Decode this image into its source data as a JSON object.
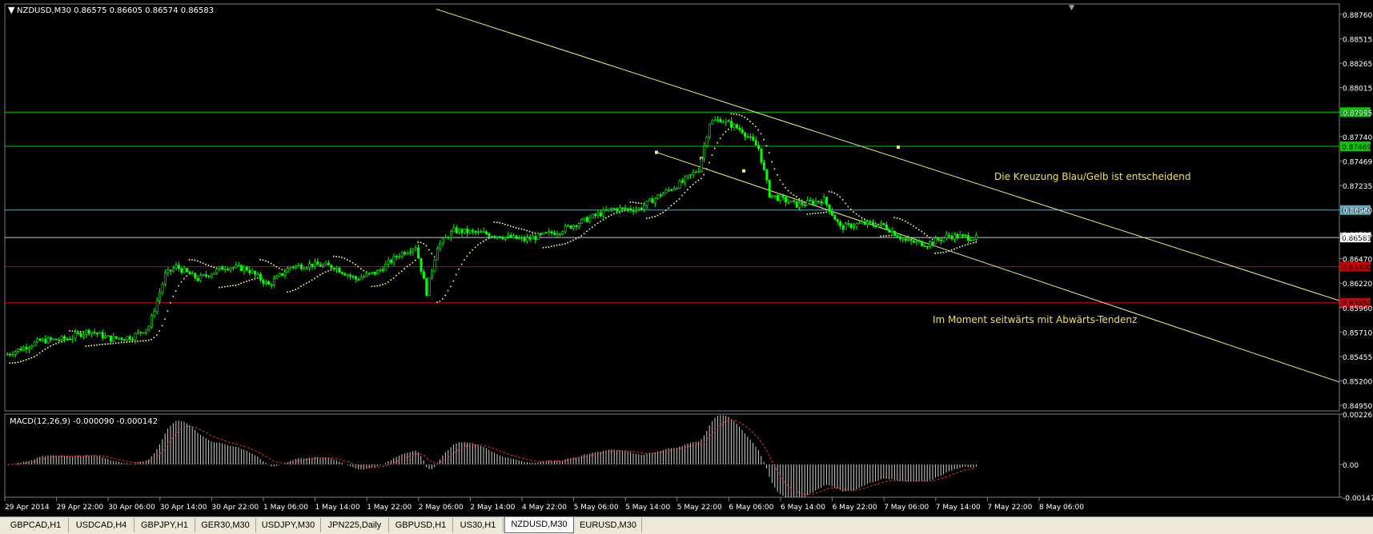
{
  "main_chart": {
    "symbol_header": "NZDUSD,M30  0.86575 0.86605 0.86574 0.86583",
    "ohlc": {
      "open": 0.86575,
      "high": 0.86605,
      "low": 0.86574,
      "close": 0.86583
    },
    "price_ticks": [
      "0.88760",
      "0.88515",
      "0.88265",
      "0.88015",
      "0.87995",
      "0.87740",
      "0.87469",
      "0.87235",
      "0.86980",
      "0.86725",
      "0.86470",
      "0.86220",
      "0.85960",
      "0.85710",
      "0.85455",
      "0.85200",
      "0.84950"
    ],
    "levels": [
      {
        "label": "0.87800",
        "price": 0.878,
        "color": "#00cc00"
      },
      {
        "label": "0.87469",
        "price": 0.87469,
        "color": "#00cc00"
      },
      {
        "label": "0.86850",
        "price": 0.8685,
        "color": "#5fa8c0"
      },
      {
        "label": "0.86583",
        "price": 0.86583,
        "color": "#c8c8c8"
      },
      {
        "label": "0.86300",
        "price": 0.863,
        "color": "#cc0000"
      },
      {
        "label": "0.85950",
        "price": 0.8595,
        "color": "#cc0000"
      }
    ],
    "annotations": {
      "crossing": "Die Kreuzung Blau/Gelb ist entscheidend",
      "sideways": "Im Moment seitwärts mit Abwärts-Tendenz"
    },
    "colors": {
      "bull": "#00ff00",
      "bear": "#00ff00",
      "trendline": "#f0f080",
      "sar": "#ffffa0"
    }
  },
  "macd": {
    "header": "MACD(12,26,9) -0.000090 -0.000142",
    "ticks": [
      "0.002265",
      "0.00",
      "-0.001473"
    ]
  },
  "time_axis": [
    "29 Apr 2014",
    "29 Apr 22:00",
    "30 Apr 06:00",
    "30 Apr 14:00",
    "30 Apr 22:00",
    "1 May 06:00",
    "1 May 14:00",
    "1 May 22:00",
    "2 May 06:00",
    "2 May 14:00",
    "4 May 22:00",
    "5 May 06:00",
    "5 May 14:00",
    "5 May 22:00",
    "6 May 06:00",
    "6 May 14:00",
    "6 May 22:00",
    "7 May 06:00",
    "7 May 14:00",
    "7 May 22:00",
    "8 May 06:00"
  ],
  "tabs": [
    "GBPCAD,H1",
    "USDCAD,H4",
    "GBPJPY,H1",
    "GER30,M30",
    "USDJPY,M30",
    "JPN225,Daily",
    "GBPUSD,H1",
    "US30,H1",
    "NZDUSD,M30",
    "EURUSD,M30"
  ],
  "active_tab": "NZDUSD,M30",
  "chart_data": {
    "type": "candlestick",
    "title": "NZDUSD,M30",
    "ylim": [
      0.849,
      0.8885
    ],
    "x_labels": [
      "29 Apr 2014",
      "29 Apr 22:00",
      "30 Apr 06:00",
      "30 Apr 14:00",
      "30 Apr 22:00",
      "1 May 06:00",
      "1 May 14:00",
      "1 May 22:00",
      "2 May 06:00",
      "2 May 14:00",
      "4 May 22:00",
      "5 May 06:00",
      "5 May 14:00",
      "5 May 22:00",
      "6 May 06:00",
      "6 May 14:00",
      "6 May 22:00",
      "7 May 06:00",
      "7 May 14:00",
      "7 May 22:00",
      "8 May 06:00"
    ],
    "close_path_keypoints": [
      [
        0,
        0.8545
      ],
      [
        12,
        0.8558
      ],
      [
        22,
        0.856
      ],
      [
        30,
        0.8568
      ],
      [
        38,
        0.856
      ],
      [
        46,
        0.8562
      ],
      [
        52,
        0.8572
      ],
      [
        58,
        0.8622
      ],
      [
        62,
        0.863
      ],
      [
        70,
        0.8618
      ],
      [
        80,
        0.863
      ],
      [
        88,
        0.8628
      ],
      [
        96,
        0.8612
      ],
      [
        104,
        0.863
      ],
      [
        112,
        0.8632
      ],
      [
        120,
        0.863
      ],
      [
        128,
        0.8618
      ],
      [
        136,
        0.8625
      ],
      [
        144,
        0.8642
      ],
      [
        150,
        0.865
      ],
      [
        154,
        0.8605
      ],
      [
        158,
        0.865
      ],
      [
        164,
        0.8665
      ],
      [
        176,
        0.8662
      ],
      [
        190,
        0.8656
      ],
      [
        202,
        0.8664
      ],
      [
        212,
        0.8675
      ],
      [
        222,
        0.8686
      ],
      [
        232,
        0.8686
      ],
      [
        240,
        0.87
      ],
      [
        248,
        0.8712
      ],
      [
        254,
        0.8725
      ],
      [
        258,
        0.877
      ],
      [
        262,
        0.8773
      ],
      [
        270,
        0.8762
      ],
      [
        276,
        0.8745
      ],
      [
        280,
        0.87
      ],
      [
        290,
        0.869
      ],
      [
        300,
        0.8695
      ],
      [
        306,
        0.8668
      ],
      [
        314,
        0.8672
      ],
      [
        322,
        0.867
      ],
      [
        330,
        0.8655
      ],
      [
        338,
        0.8652
      ],
      [
        346,
        0.866
      ],
      [
        356,
        0.8658
      ]
    ],
    "trendlines": [
      {
        "name": "upper channel",
        "from": [
          "29 Apr 22:00",
          0.888
        ],
        "to": [
          "8 May 06:00",
          0.8597
        ]
      },
      {
        "name": "lower channel",
        "from": [
          "5 May 14:00",
          0.8741
        ],
        "to": [
          "8 May 06:00",
          0.8518
        ]
      }
    ],
    "macd": {
      "signal": "MACD(12,26,9)",
      "main": -9e-05,
      "signal_value": -0.000142,
      "ylim": [
        -0.001473,
        0.002265
      ]
    }
  }
}
